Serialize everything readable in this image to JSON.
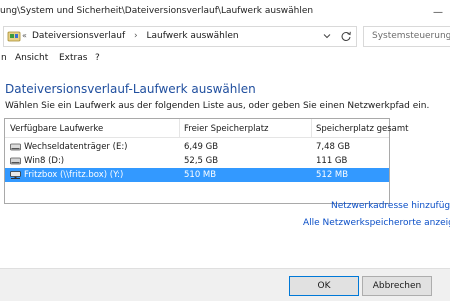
{
  "window": {
    "title": "ung\\System und Sicherheit\\Dateiversionsverlauf\\Laufwerk auswählen",
    "minimize_glyph": "—"
  },
  "address": {
    "overflow": "«",
    "crumbs": [
      "Dateiversionsverlauf",
      "Laufwerk auswählen"
    ],
    "separator": "›",
    "search_placeholder": "Systemsteuerung d"
  },
  "menu": {
    "items": [
      "n",
      "Ansicht",
      "Extras",
      "?"
    ]
  },
  "content": {
    "title": "Dateiversionsverlauf-Laufwerk auswählen",
    "instruction": "Wählen Sie ein Laufwerk aus der folgenden Liste aus, oder geben Sie einen Netzwerkpfad ein."
  },
  "drives": {
    "columns": [
      "Verfügbare Laufwerke",
      "Freier Speicherplatz",
      "Speicherplatz gesamt"
    ],
    "rows": [
      {
        "name": "Wechseldatenträger (E:)",
        "free": "6,49 GB",
        "total": "7,48 GB",
        "icon": "removable-drive-icon"
      },
      {
        "name": "Win8 (D:)",
        "free": "52,5 GB",
        "total": "111 GB",
        "icon": "local-drive-icon"
      },
      {
        "name": "Fritzbox (\\\\fritz.box) (Y:)",
        "free": "510 MB",
        "total": "512 MB",
        "icon": "network-drive-icon",
        "selected": true
      }
    ]
  },
  "links": {
    "add_network": "Netzwerkadresse hinzufügen",
    "show_all": "Alle Netzwerkspeicherorte anzeigen"
  },
  "buttons": {
    "ok": "OK",
    "cancel": "Abbrechen"
  },
  "colors": {
    "title": "#1f4e9e",
    "selection": "#3399ff",
    "link": "#0b4fc7"
  }
}
